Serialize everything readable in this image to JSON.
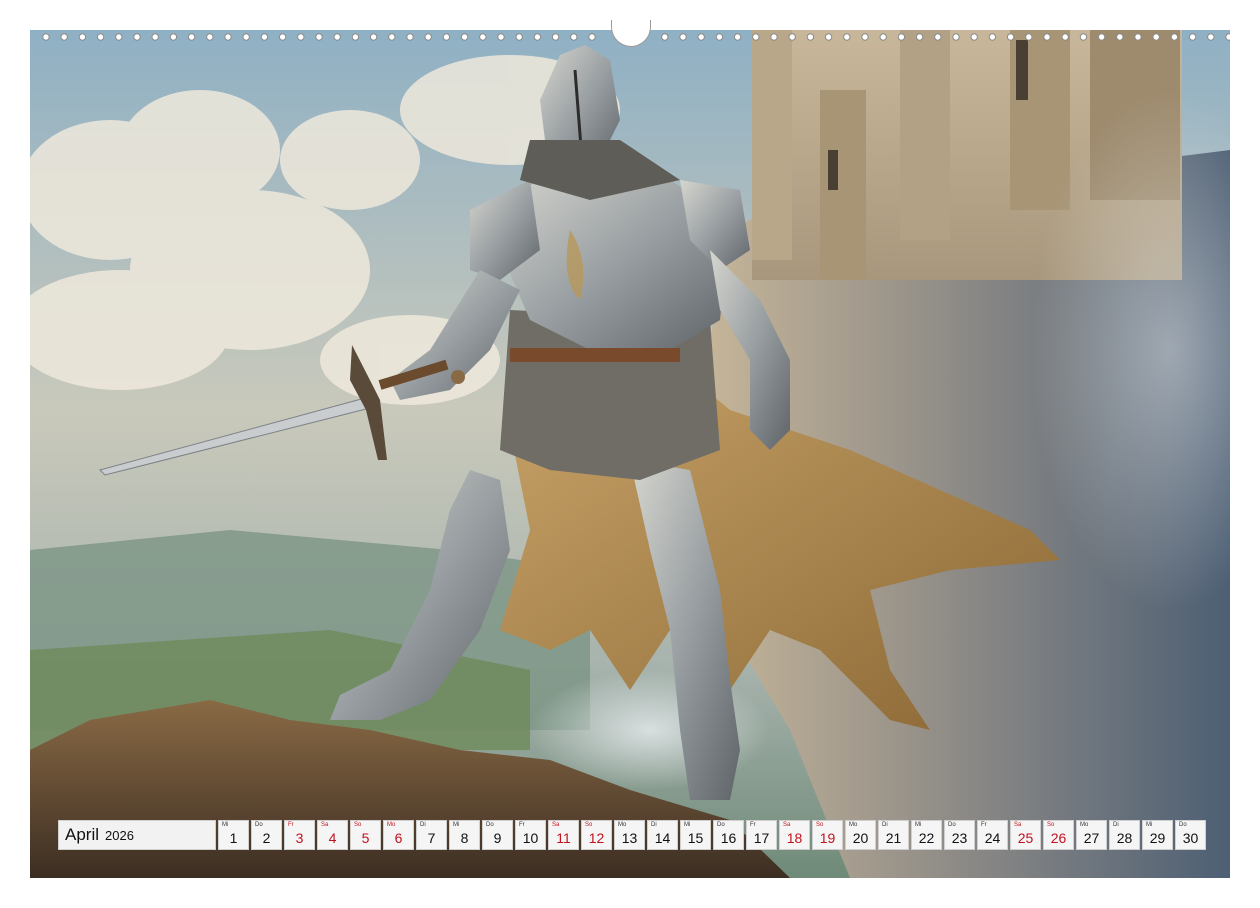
{
  "calendar": {
    "month": "April",
    "year": "2026",
    "days": [
      {
        "wd": "Mi",
        "d": "1",
        "red": false
      },
      {
        "wd": "Do",
        "d": "2",
        "red": false
      },
      {
        "wd": "Fr",
        "d": "3",
        "red": true
      },
      {
        "wd": "Sa",
        "d": "4",
        "red": true
      },
      {
        "wd": "So",
        "d": "5",
        "red": true
      },
      {
        "wd": "Mo",
        "d": "6",
        "red": true
      },
      {
        "wd": "Di",
        "d": "7",
        "red": false
      },
      {
        "wd": "Mi",
        "d": "8",
        "red": false
      },
      {
        "wd": "Do",
        "d": "9",
        "red": false
      },
      {
        "wd": "Fr",
        "d": "10",
        "red": false
      },
      {
        "wd": "Sa",
        "d": "11",
        "red": true
      },
      {
        "wd": "So",
        "d": "12",
        "red": true
      },
      {
        "wd": "Mo",
        "d": "13",
        "red": false
      },
      {
        "wd": "Di",
        "d": "14",
        "red": false
      },
      {
        "wd": "Mi",
        "d": "15",
        "red": false
      },
      {
        "wd": "Do",
        "d": "16",
        "red": false
      },
      {
        "wd": "Fr",
        "d": "17",
        "red": false
      },
      {
        "wd": "Sa",
        "d": "18",
        "red": true
      },
      {
        "wd": "So",
        "d": "19",
        "red": true
      },
      {
        "wd": "Mo",
        "d": "20",
        "red": false
      },
      {
        "wd": "Di",
        "d": "21",
        "red": false
      },
      {
        "wd": "Mi",
        "d": "22",
        "red": false
      },
      {
        "wd": "Do",
        "d": "23",
        "red": false
      },
      {
        "wd": "Fr",
        "d": "24",
        "red": false
      },
      {
        "wd": "Sa",
        "d": "25",
        "red": true
      },
      {
        "wd": "So",
        "d": "26",
        "red": true
      },
      {
        "wd": "Mo",
        "d": "27",
        "red": false
      },
      {
        "wd": "Di",
        "d": "28",
        "red": false
      },
      {
        "wd": "Mi",
        "d": "29",
        "red": false
      },
      {
        "wd": "Do",
        "d": "30",
        "red": false
      }
    ]
  },
  "colors": {
    "holiday_red": "#c0121f",
    "cell_bg": "#f5f5f5"
  }
}
